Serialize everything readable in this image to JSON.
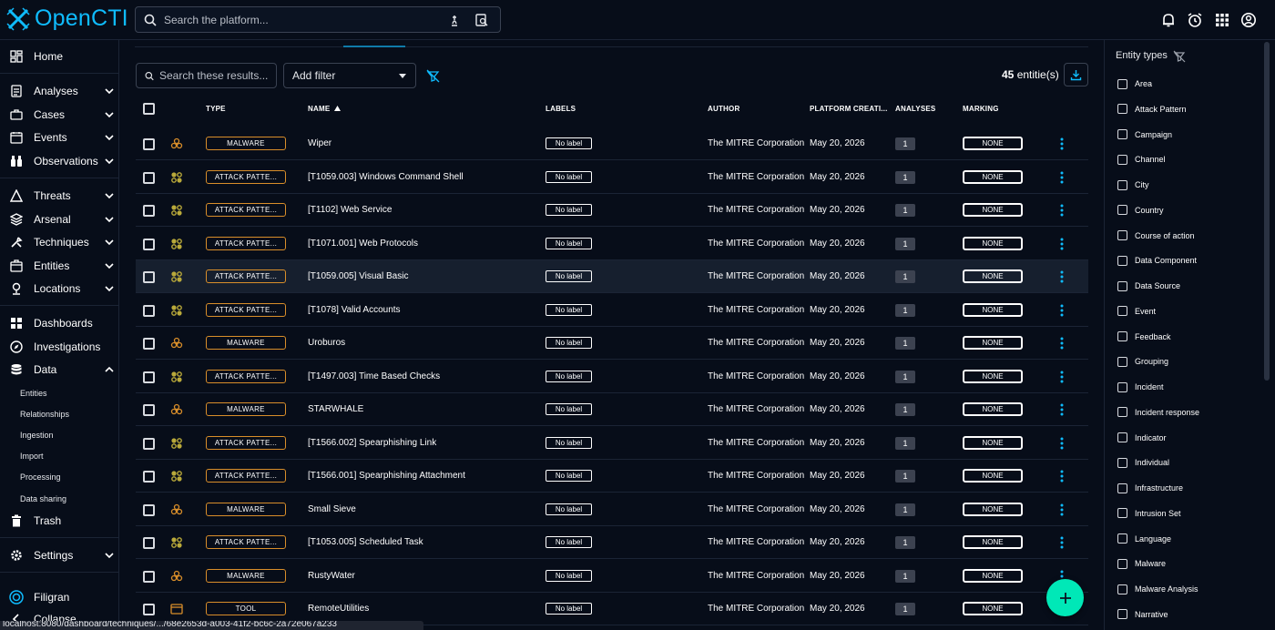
{
  "brand": {
    "name": "OpenCTI",
    "color": "#0fbcff"
  },
  "topbar": {
    "search_placeholder": "Search the platform...",
    "icons": [
      "search-icon",
      "ai-hand-icon",
      "image-search-icon",
      "bell-icon",
      "alarm-icon",
      "apps-grid-icon",
      "account-circle-icon"
    ]
  },
  "sidebar": {
    "items": [
      {
        "label": "Home",
        "icon": "dashboard-icon"
      },
      {
        "label": "Analyses",
        "icon": "analyses-icon",
        "expandable": true
      },
      {
        "label": "Cases",
        "icon": "cases-icon",
        "expandable": true
      },
      {
        "label": "Events",
        "icon": "events-icon",
        "expandable": true
      },
      {
        "label": "Observations",
        "icon": "binoculars-icon",
        "expandable": true
      },
      {
        "label": "Threats",
        "icon": "threats-icon",
        "expandable": true
      },
      {
        "label": "Arsenal",
        "icon": "arsenal-icon",
        "expandable": true
      },
      {
        "label": "Techniques",
        "icon": "techniques-icon",
        "expandable": true
      },
      {
        "label": "Entities",
        "icon": "entities-icon",
        "expandable": true
      },
      {
        "label": "Locations",
        "icon": "locations-icon",
        "expandable": true
      },
      {
        "label": "Dashboards",
        "icon": "dashboards-icon"
      },
      {
        "label": "Investigations",
        "icon": "compass-icon"
      },
      {
        "label": "Data",
        "icon": "database-icon",
        "expanded": true
      },
      {
        "label": "Trash",
        "icon": "trash-icon"
      },
      {
        "label": "Settings",
        "icon": "settings-icon",
        "expandable": true
      },
      {
        "label": "Filigran",
        "icon": "filigran-icon"
      },
      {
        "label": "Collapse",
        "icon": "collapse-icon"
      }
    ],
    "data_subitems": [
      "Entities",
      "Relationships",
      "Ingestion",
      "Import",
      "Processing",
      "Data sharing"
    ]
  },
  "toolbar": {
    "search_placeholder": "Search these results...",
    "add_filter_label": "Add filter",
    "entity_count": "45",
    "entity_count_suffix": " entitie(s)"
  },
  "table": {
    "columns": [
      "TYPE",
      "NAME",
      "LABELS",
      "AUTHOR",
      "PLATFORM CREATI...",
      "ANALYSES",
      "MARKING"
    ],
    "sort": {
      "column": "NAME",
      "direction": "asc"
    },
    "rows": [
      {
        "type": "MALWARE",
        "icon": "biohazard-icon",
        "name": "Wiper",
        "label": "No label",
        "author": "The MITRE Corporation",
        "date": "May 20, 2026",
        "analyses": "1",
        "marking": "NONE"
      },
      {
        "type": "ATTACK PATTE...",
        "icon": "attack-pattern-icon",
        "name": "[T1059.003] Windows Command Shell",
        "label": "No label",
        "author": "The MITRE Corporation",
        "date": "May 20, 2026",
        "analyses": "1",
        "marking": "NONE"
      },
      {
        "type": "ATTACK PATTE...",
        "icon": "attack-pattern-icon",
        "name": "[T1102] Web Service",
        "label": "No label",
        "author": "The MITRE Corporation",
        "date": "May 20, 2026",
        "analyses": "1",
        "marking": "NONE"
      },
      {
        "type": "ATTACK PATTE...",
        "icon": "attack-pattern-icon",
        "name": "[T1071.001] Web Protocols",
        "label": "No label",
        "author": "The MITRE Corporation",
        "date": "May 20, 2026",
        "analyses": "1",
        "marking": "NONE"
      },
      {
        "type": "ATTACK PATTE...",
        "icon": "attack-pattern-icon",
        "name": "[T1059.005] Visual Basic",
        "label": "No label",
        "author": "The MITRE Corporation",
        "date": "May 20, 2026",
        "analyses": "1",
        "marking": "NONE",
        "hovered": true
      },
      {
        "type": "ATTACK PATTE...",
        "icon": "attack-pattern-icon",
        "name": "[T1078] Valid Accounts",
        "label": "No label",
        "author": "The MITRE Corporation",
        "date": "May 20, 2026",
        "analyses": "1",
        "marking": "NONE"
      },
      {
        "type": "MALWARE",
        "icon": "biohazard-icon",
        "name": "Uroburos",
        "label": "No label",
        "author": "The MITRE Corporation",
        "date": "May 20, 2026",
        "analyses": "1",
        "marking": "NONE"
      },
      {
        "type": "ATTACK PATTE...",
        "icon": "attack-pattern-icon",
        "name": "[T1497.003] Time Based Checks",
        "label": "No label",
        "author": "The MITRE Corporation",
        "date": "May 20, 2026",
        "analyses": "1",
        "marking": "NONE"
      },
      {
        "type": "MALWARE",
        "icon": "biohazard-icon",
        "name": "STARWHALE",
        "label": "No label",
        "author": "The MITRE Corporation",
        "date": "May 20, 2026",
        "analyses": "1",
        "marking": "NONE"
      },
      {
        "type": "ATTACK PATTE...",
        "icon": "attack-pattern-icon",
        "name": "[T1566.002] Spearphishing Link",
        "label": "No label",
        "author": "The MITRE Corporation",
        "date": "May 20, 2026",
        "analyses": "1",
        "marking": "NONE"
      },
      {
        "type": "ATTACK PATTE...",
        "icon": "attack-pattern-icon",
        "name": "[T1566.001] Spearphishing Attachment",
        "label": "No label",
        "author": "The MITRE Corporation",
        "date": "May 20, 2026",
        "analyses": "1",
        "marking": "NONE"
      },
      {
        "type": "MALWARE",
        "icon": "biohazard-icon",
        "name": "Small Sieve",
        "label": "No label",
        "author": "The MITRE Corporation",
        "date": "May 20, 2026",
        "analyses": "1",
        "marking": "NONE"
      },
      {
        "type": "ATTACK PATTE...",
        "icon": "attack-pattern-icon",
        "name": "[T1053.005] Scheduled Task",
        "label": "No label",
        "author": "The MITRE Corporation",
        "date": "May 20, 2026",
        "analyses": "1",
        "marking": "NONE"
      },
      {
        "type": "MALWARE",
        "icon": "biohazard-icon",
        "name": "RustyWater",
        "label": "No label",
        "author": "The MITRE Corporation",
        "date": "May 20, 2026",
        "analyses": "1",
        "marking": "NONE"
      },
      {
        "type": "TOOL",
        "icon": "tool-window-icon",
        "name": "RemoteUtilities",
        "label": "No label",
        "author": "The MITRE Corporation",
        "date": "May 20, 2026",
        "analyses": "1",
        "marking": "NONE"
      }
    ]
  },
  "entity_panel": {
    "title": "Entity types",
    "items": [
      "Area",
      "Attack Pattern",
      "Campaign",
      "Channel",
      "City",
      "Country",
      "Course of action",
      "Data Component",
      "Data Source",
      "Event",
      "Feedback",
      "Grouping",
      "Incident",
      "Incident response",
      "Indicator",
      "Individual",
      "Infrastructure",
      "Intrusion Set",
      "Language",
      "Malware",
      "Malware Analysis",
      "Narrative"
    ]
  },
  "statusbar": {
    "url": "localhost:8080/dashboard/techniques/.../68e2653d-a003-41f2-bc6c-2a72e067a233"
  },
  "colors": {
    "accent": "#0fbcff",
    "fab": "#00e8b7",
    "type_border": "#d98e2a",
    "attack_icon": "#b9a93a",
    "malware_icon": "#d98e2a"
  }
}
